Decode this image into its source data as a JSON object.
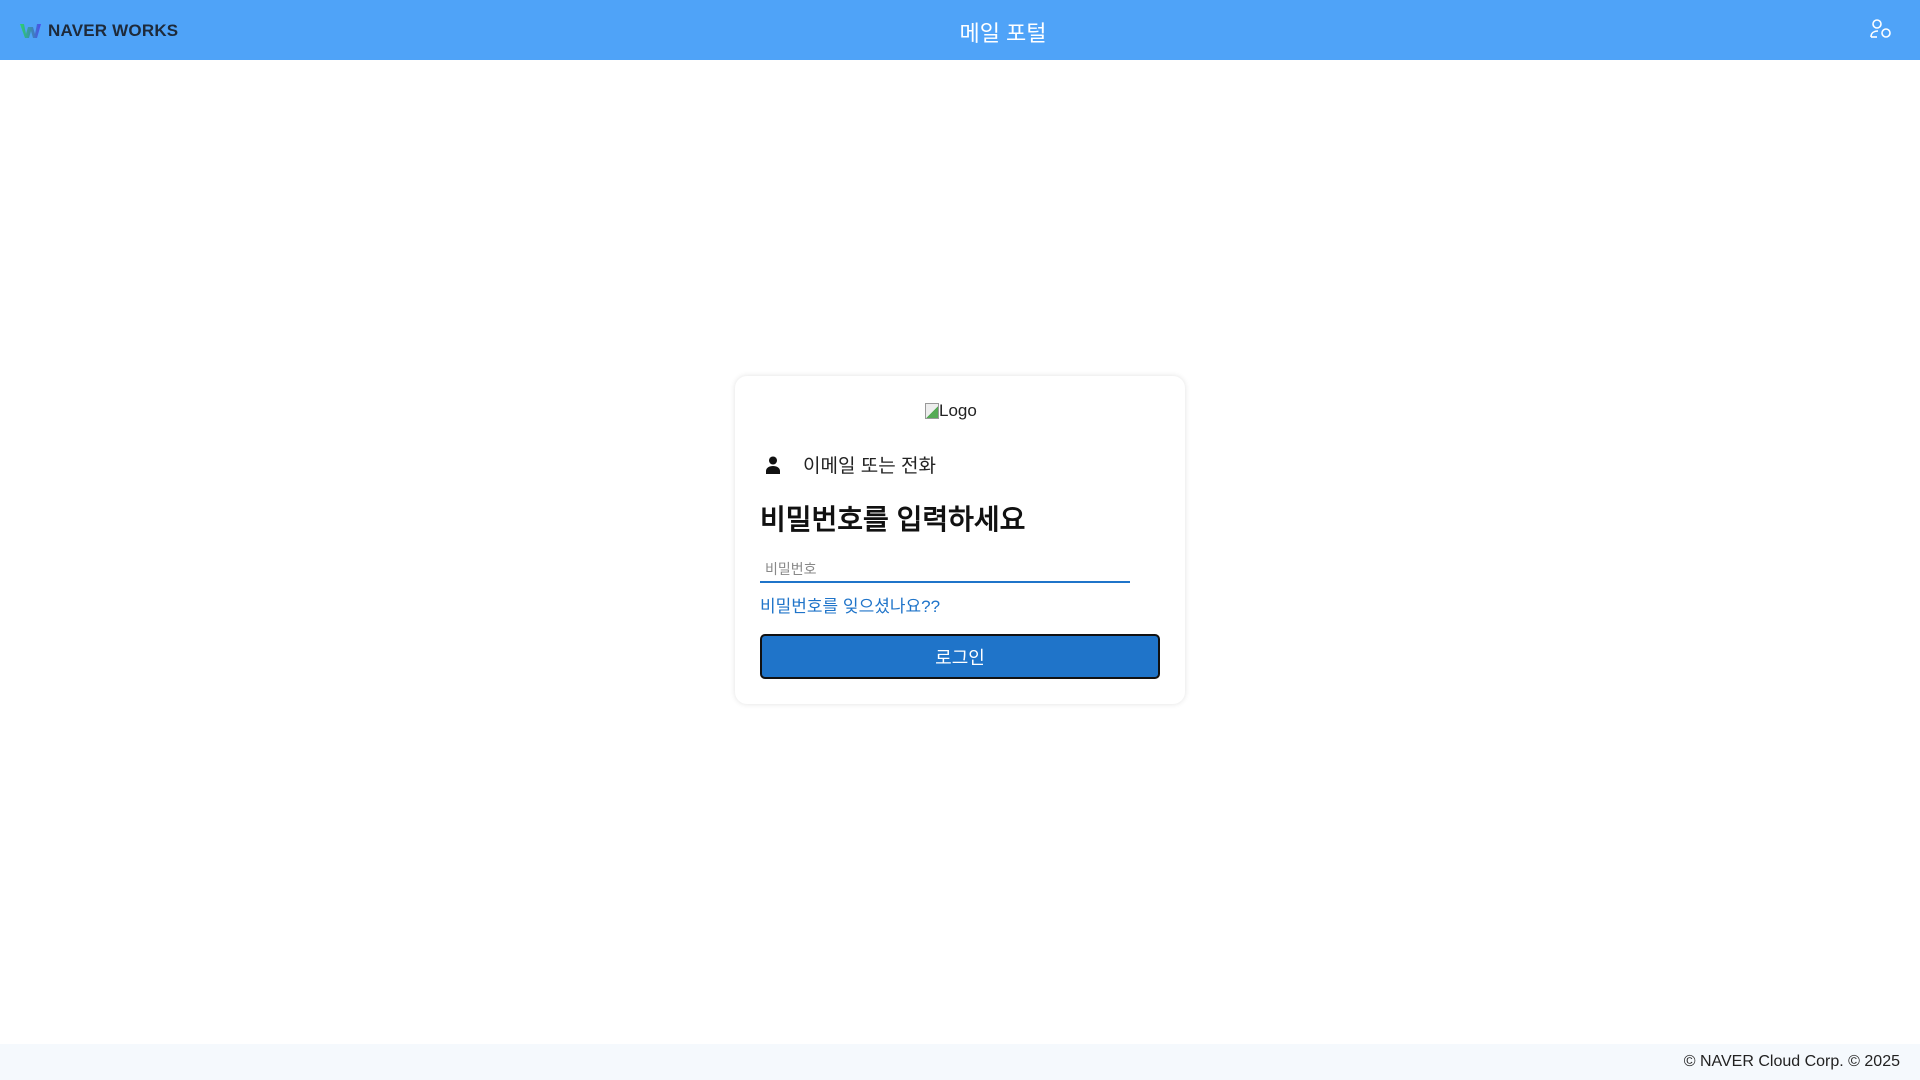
{
  "header": {
    "brand": "NAVER WORKS",
    "title": "메일 포털",
    "user_icon": "user-switch-icon"
  },
  "card": {
    "logo_alt": "Logo",
    "identity": "이메일 또는 전화",
    "heading": "비밀번호를 입력하세요",
    "password_placeholder": "비밀번호",
    "password_value": "",
    "forgot_link": "비밀번호를 잊으셨나요??",
    "login_label": "로그인"
  },
  "footer": {
    "copyright": "© NAVER Cloud Corp. © 2025"
  },
  "colors": {
    "header": "#4fa3f8",
    "accent": "#1f74c9"
  }
}
